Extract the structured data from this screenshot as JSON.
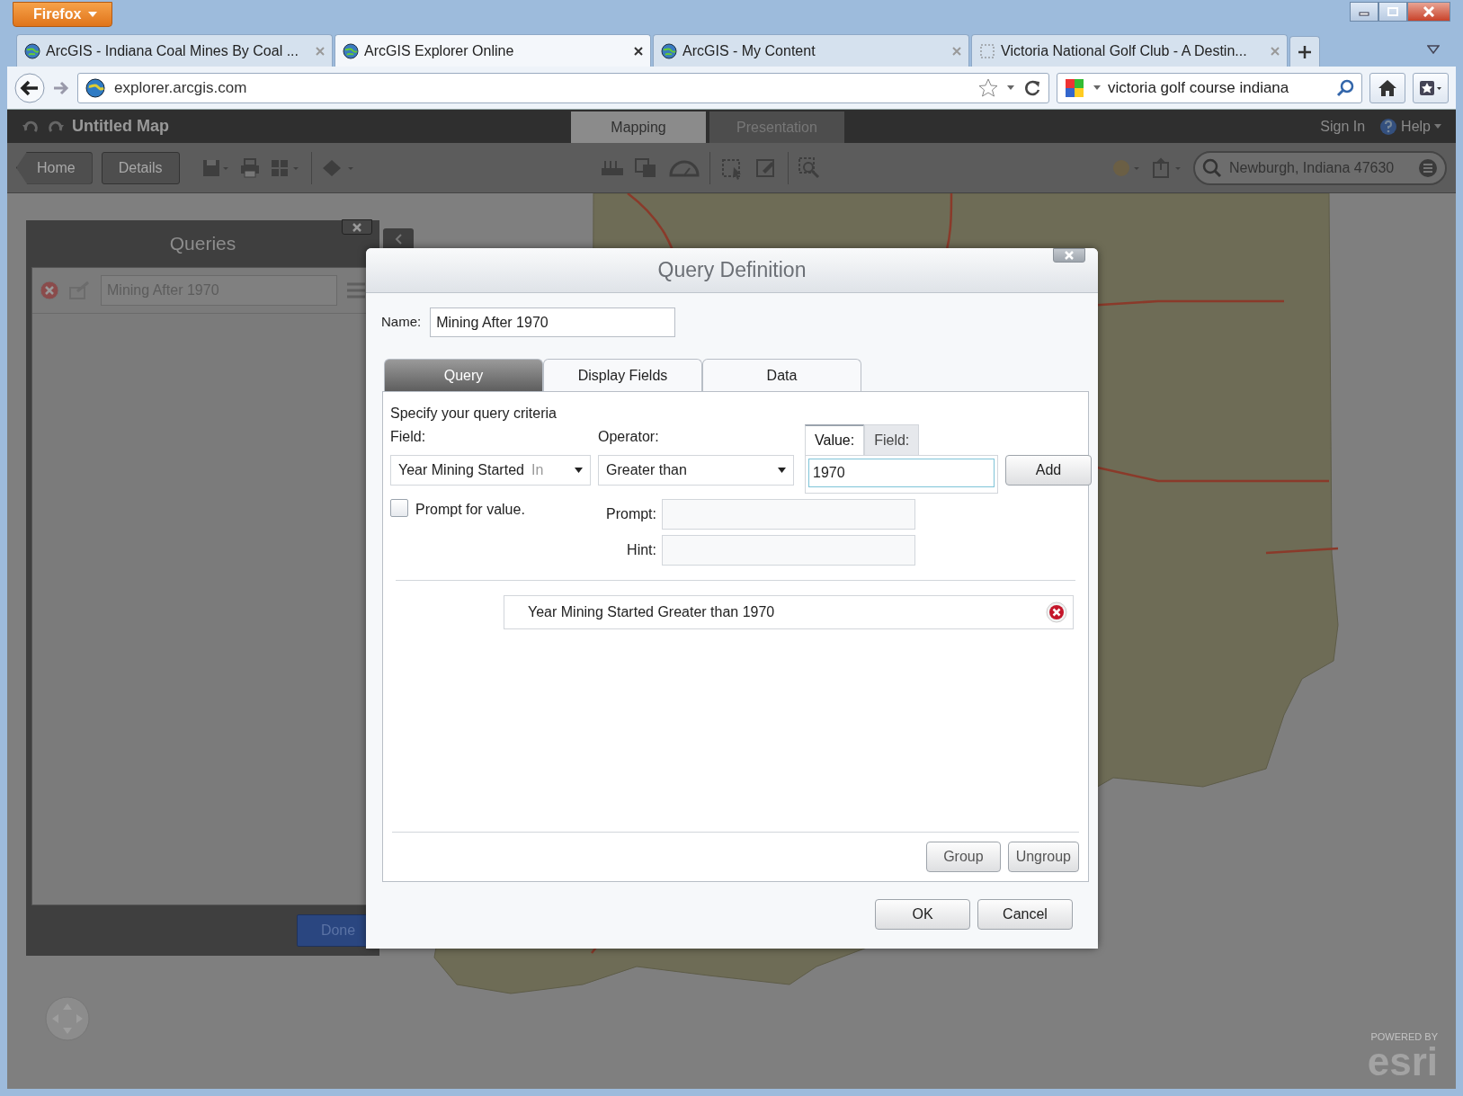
{
  "browser": {
    "menu_button": "Firefox",
    "tabs": [
      {
        "title": "ArcGIS - Indiana Coal Mines By Coal ...",
        "selected": false
      },
      {
        "title": "ArcGIS Explorer Online",
        "selected": true
      },
      {
        "title": "ArcGIS - My Content",
        "selected": false
      },
      {
        "title": "Victoria National Golf Club - A Destin...",
        "selected": false
      }
    ],
    "url": "explorer.arcgis.com",
    "search": "victoria golf course indiana"
  },
  "app": {
    "title": "Untitled Map",
    "tabs": [
      {
        "label": "Mapping",
        "selected": true
      },
      {
        "label": "Presentation",
        "selected": false
      }
    ],
    "header_links": [
      "Sign In",
      "Help"
    ],
    "nav_buttons": [
      "Home",
      "Details"
    ],
    "search": "Newburgh, Indiana 47630"
  },
  "queries_panel": {
    "title": "Queries",
    "items": [
      {
        "name": "Mining After 1970"
      }
    ],
    "done_button": "Done"
  },
  "dialog": {
    "title": "Query Definition",
    "name_label": "Name:",
    "name_value": "Mining After 1970",
    "tabs": [
      {
        "label": "Query",
        "selected": true
      },
      {
        "label": "Display Fields",
        "selected": false
      },
      {
        "label": "Data",
        "selected": false
      }
    ],
    "criteria_heading": "Specify your query criteria",
    "field_label": "Field:",
    "operator_label": "Operator:",
    "field_select": {
      "value": "Year Mining Started",
      "type_hint": "In"
    },
    "operator_select": "Greater than",
    "value_tabs": [
      {
        "label": "Value:",
        "selected": true
      },
      {
        "label": "Field:",
        "selected": false
      }
    ],
    "value": "1970",
    "add_button": "Add",
    "prompt_checkbox": {
      "label": "Prompt for value.",
      "checked": false
    },
    "prompt_label": "Prompt:",
    "hint_label": "Hint:",
    "expressions": [
      "Year Mining Started Greater than 1970"
    ],
    "group_buttons": [
      "Group",
      "Ungroup"
    ],
    "buttons": [
      "OK",
      "Cancel"
    ]
  },
  "map": {
    "powered_by": "POWERED BY",
    "logo": "esri"
  }
}
